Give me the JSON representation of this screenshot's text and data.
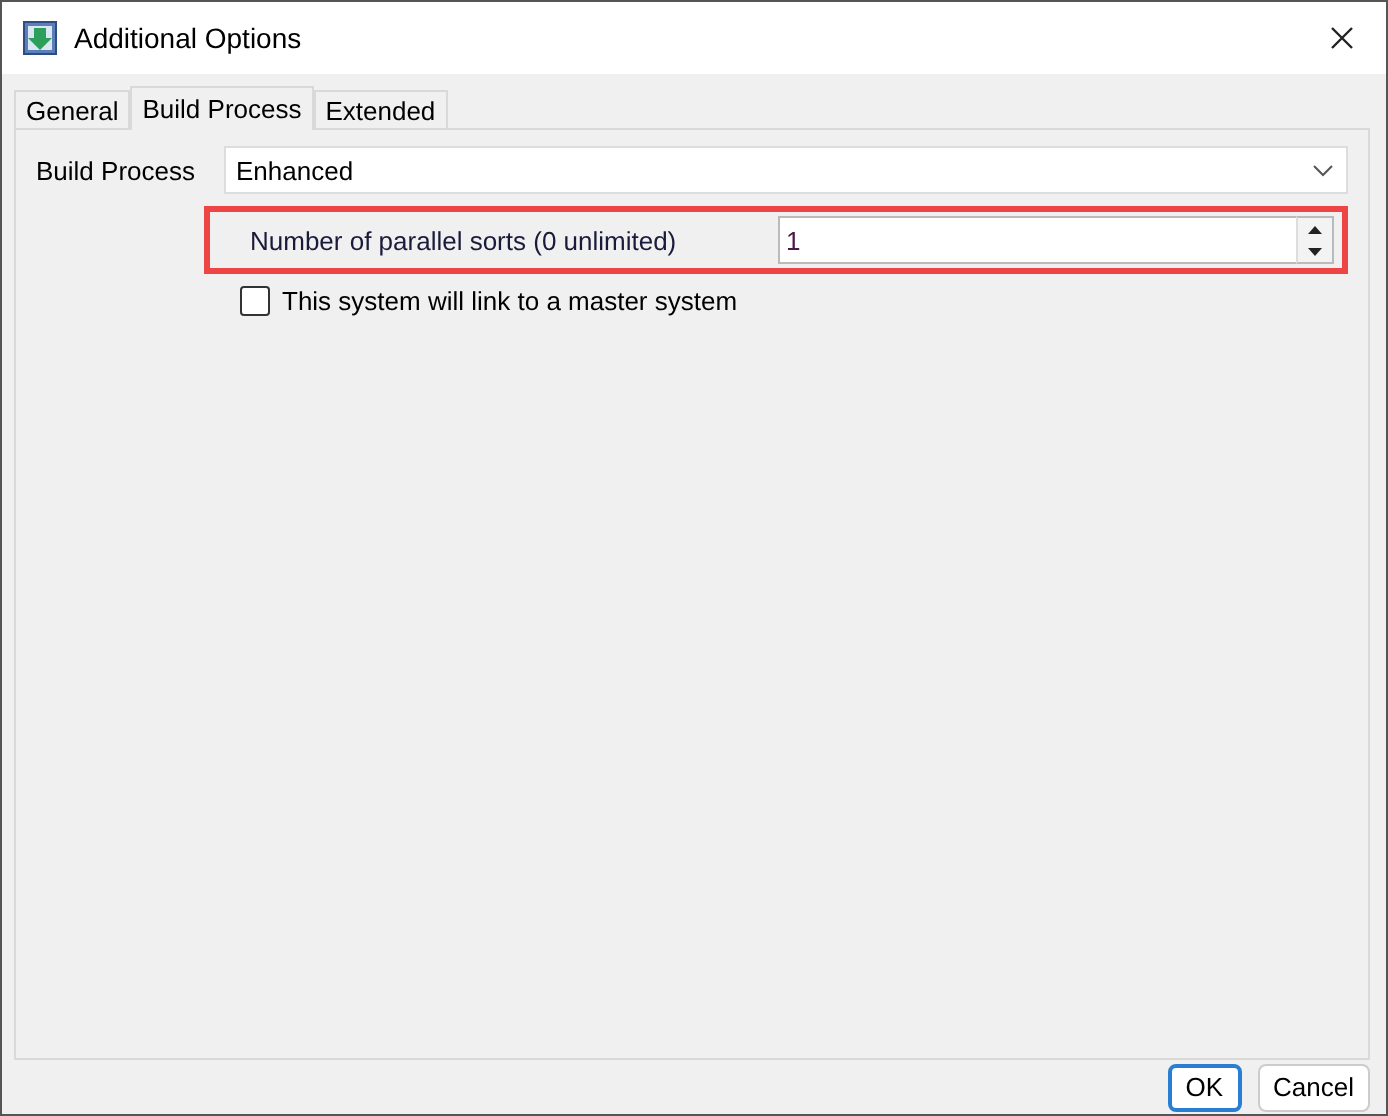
{
  "window": {
    "title": "Additional Options"
  },
  "tabs": [
    {
      "label": "General",
      "selected": false
    },
    {
      "label": "Build Process",
      "selected": true
    },
    {
      "label": "Extended",
      "selected": false
    }
  ],
  "build_process": {
    "label": "Build Process",
    "value": "Enhanced"
  },
  "parallel_sorts": {
    "label": "Number of parallel sorts (0 unlimited)",
    "value": "1",
    "highlighted": true
  },
  "master_link": {
    "label": "This system will link to a master system",
    "checked": false
  },
  "buttons": [
    {
      "label": "OK",
      "default": true
    },
    {
      "label": "Cancel",
      "default": false
    }
  ]
}
